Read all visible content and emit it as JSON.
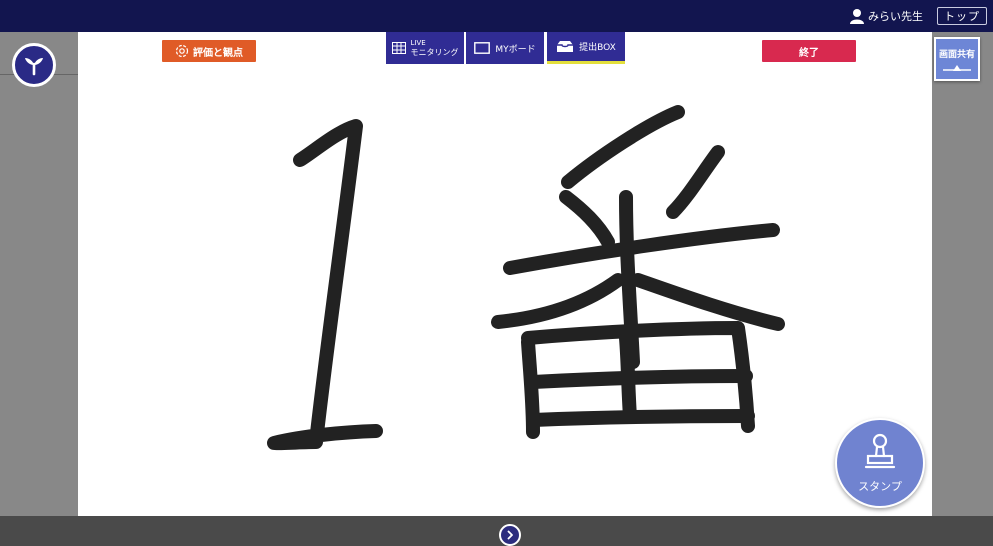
{
  "topbar": {
    "user_name": "みらい先生",
    "top_label": "トップ"
  },
  "toolbar": {
    "eval_label": "評価と観点",
    "live_label_line1": "LIVE",
    "live_label_line2": "モニタリング",
    "my_board_label": "MYボード",
    "submit_box_label": "提出BOX",
    "end_label": "終了",
    "share_label": "画面共有"
  },
  "canvas": {
    "handwritten_text": "1番",
    "ink_color": "#222222"
  },
  "stamp": {
    "label": "スタンプ"
  },
  "colors": {
    "topbar": "#12154f",
    "tab": "#302c94",
    "eval": "#e05b27",
    "end": "#d8294f",
    "share": "#6d86d6",
    "stamp": "#7083d0",
    "active_underline": "#e3df3c"
  },
  "icons": {
    "user": "user-icon",
    "logo": "sprout-logo-icon",
    "eval": "flower-icon",
    "live": "grid-icon",
    "my_board": "board-icon",
    "submit_box": "inbox-icon",
    "share": "share-screen-icon",
    "stamp": "stamp-icon",
    "next": "chevron-right-icon"
  }
}
